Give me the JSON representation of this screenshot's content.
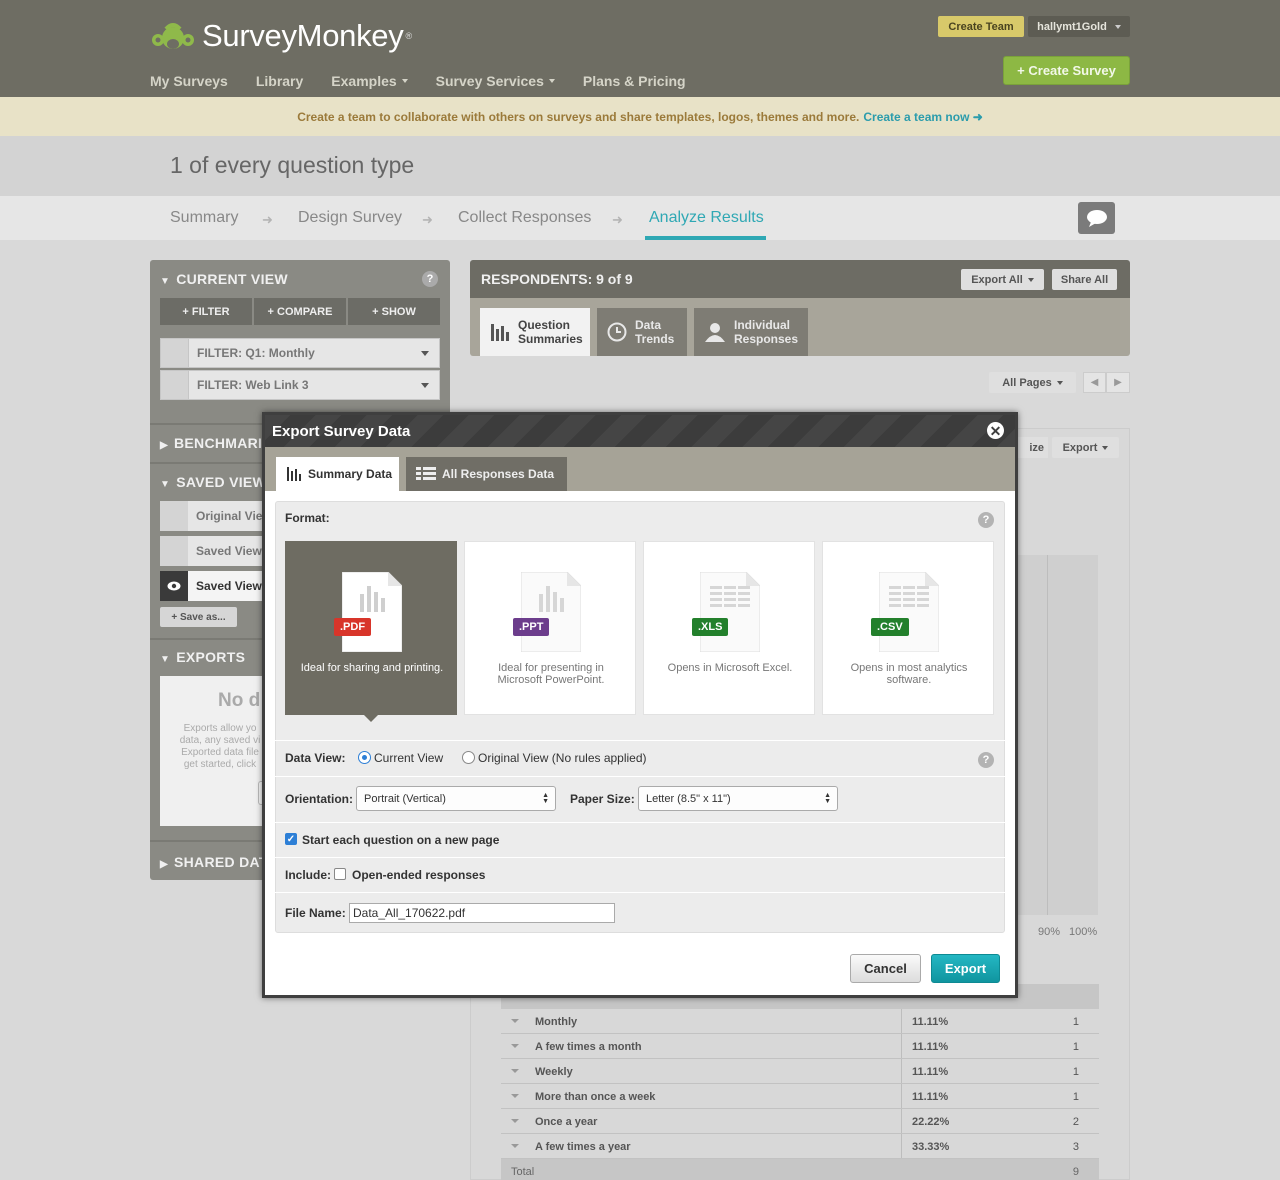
{
  "header": {
    "logo_text": "SurveyMonkey",
    "logo_reg": "®",
    "nav": [
      "My Surveys",
      "Library",
      "Examples",
      "Survey Services",
      "Plans & Pricing"
    ],
    "create_team": "Create Team",
    "username": "hallymt1Gold",
    "create_survey": "+ Create Survey"
  },
  "banner": {
    "message": "Create a team to collaborate with others on surveys and share templates, logos, themes and more.",
    "link": "Create a team now ➜"
  },
  "survey": {
    "title": "1 of every question type",
    "steps": [
      "Summary",
      "Design Survey",
      "Collect Responses",
      "Analyze Results"
    ],
    "arrow": "➜"
  },
  "left_panel": {
    "current_view": "CURRENT VIEW",
    "help": "?",
    "buttons": [
      "+ FILTER",
      "+ COMPARE",
      "+ SHOW"
    ],
    "filters": [
      "FILTER:  Q1: Monthly",
      "FILTER:  Web Link 3"
    ],
    "benchmark": "BENCHMARI",
    "saved_views": "SAVED VIEW",
    "saved": [
      "Original Vie",
      "Saved View",
      "Saved View"
    ],
    "save_as": "+ Save as...",
    "exports": "EXPORTS",
    "no_data": "No d",
    "exports_desc": [
      "Exports allow yo",
      "data, any saved vi",
      "Exported data file",
      "get started, click"
    ],
    "shared": "SHARED DAT"
  },
  "results": {
    "respondents": "RESPONDENTS: 9 of 9",
    "export_all": "Export All",
    "share_all": "Share All",
    "tabs": [
      {
        "line1": "Question",
        "line2": "Summaries"
      },
      {
        "line1": "Data",
        "line2": "Trends"
      },
      {
        "line1": "Individual",
        "line2": "Responses"
      }
    ],
    "all_pages": "All Pages",
    "prev": "◀",
    "next": "▶",
    "customize_partial": "ize",
    "export": "Export",
    "ticks": [
      "90%",
      "100%"
    ],
    "rows": [
      {
        "label": "Monthly",
        "pct": "11.11%",
        "count": "1"
      },
      {
        "label": "A few times a month",
        "pct": "11.11%",
        "count": "1"
      },
      {
        "label": "Weekly",
        "pct": "11.11%",
        "count": "1"
      },
      {
        "label": "More than once a week",
        "pct": "11.11%",
        "count": "1"
      },
      {
        "label": "Once a year",
        "pct": "22.22%",
        "count": "2"
      },
      {
        "label": "A few times a year",
        "pct": "33.33%",
        "count": "3"
      }
    ],
    "total_label": "Total",
    "total_count": "9"
  },
  "modal": {
    "title": "Export Survey Data",
    "close": "✕",
    "tabs": [
      "Summary Data",
      "All Responses Data"
    ],
    "format_label": "Format:",
    "help": "?",
    "formats": [
      {
        "badge": ".PDF",
        "desc": "Ideal for sharing and printing.",
        "color": "#d8352a"
      },
      {
        "badge": ".PPT",
        "desc": "Ideal for presenting in Microsoft PowerPoint.",
        "color": "#6c3d8c"
      },
      {
        "badge": ".XLS",
        "desc": "Opens in Microsoft Excel.",
        "color": "#23802c"
      },
      {
        "badge": ".CSV",
        "desc": "Opens in most analytics software.",
        "color": "#23802c"
      }
    ],
    "data_view_label": "Data View:",
    "data_view_options": [
      "Current View",
      "Original View (No rules applied)"
    ],
    "orientation_label": "Orientation:",
    "orientation_value": "Portrait (Vertical)",
    "paper_size_label": "Paper Size:",
    "paper_size_value": "Letter (8.5\" x 11\")",
    "new_page_label": "Start each question on a new page",
    "include_label": "Include:",
    "open_ended_label": "Open-ended responses",
    "file_name_label": "File Name:",
    "file_name_value": "Data_All_170622.pdf",
    "cancel": "Cancel",
    "export": "Export"
  }
}
